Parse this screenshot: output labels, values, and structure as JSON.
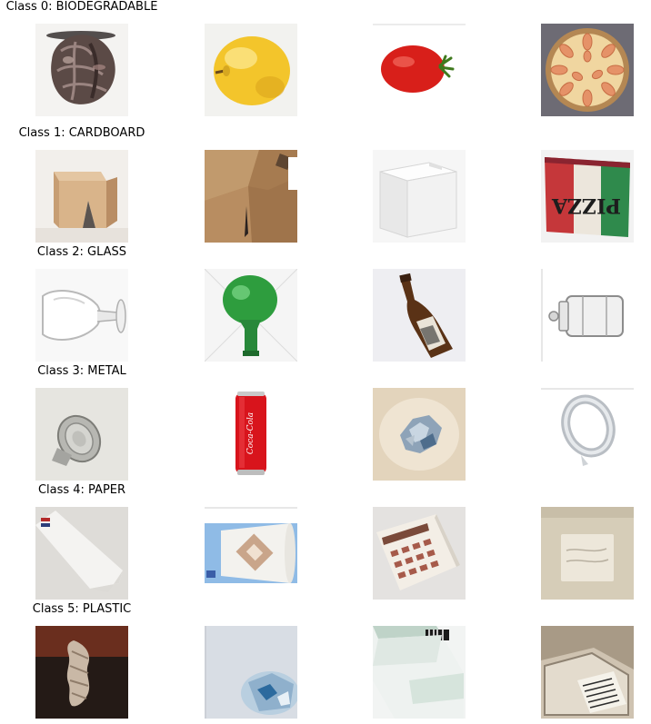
{
  "rows": [
    {
      "title": "Class 0: BIODEGRADABLE",
      "items": [
        "shriveled-food-waste-image",
        "yellow-apple-image",
        "red-tomato-image",
        "fruit-tart-image"
      ]
    },
    {
      "title": "Class 1: CARDBOARD",
      "items": [
        "folded-cardboard-stand-image",
        "cardboard-box-closeup-image",
        "white-carton-box-image",
        "pizza-box-image"
      ]
    },
    {
      "title": "Class 2: GLASS",
      "items": [
        "wine-glass-image",
        "green-glass-bottle-image",
        "brown-beer-bottle-image",
        "glass-jar-image"
      ]
    },
    {
      "title": "Class 3: METAL",
      "items": [
        "crushed-tin-can-image",
        "coca-cola-can-image",
        "aluminum-foil-ball-image",
        "aluminum-foil-ring-image"
      ]
    },
    {
      "title": "Class 4: PAPER",
      "items": [
        "paper-packet-image",
        "paper-cup-image",
        "paper-catalog-image",
        "paper-bag-image"
      ]
    },
    {
      "title": "Class 5: PLASTIC",
      "items": [
        "twisted-plastic-bottle-image",
        "crushed-plastic-bottle-image",
        "plastic-jug-image",
        "plastic-container-image"
      ]
    }
  ],
  "labels": {
    "coca_cola": "Coca-Cola",
    "pizza": "PIZZA"
  }
}
